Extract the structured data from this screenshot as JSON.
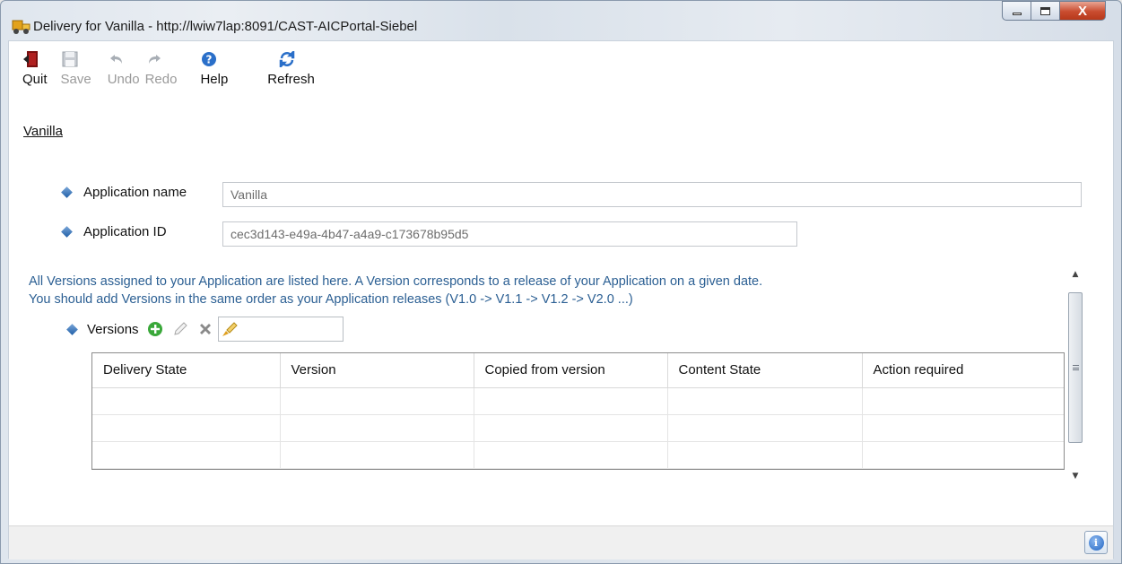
{
  "window": {
    "title": "Delivery for Vanilla - http://lwiw7lap:8091/CAST-AICPortal-Siebel",
    "app_icon": "delivery-truck-icon",
    "close_glyph": "X"
  },
  "toolbar": {
    "items": [
      {
        "label": "Quit",
        "icon": "quit-door-icon",
        "enabled": true
      },
      {
        "label": "Save",
        "icon": "save-disk-icon",
        "enabled": false
      },
      {
        "label": "Undo",
        "icon": "undo-arrow-icon",
        "enabled": false
      },
      {
        "label": "Redo",
        "icon": "redo-arrow-icon",
        "enabled": false
      },
      {
        "label": "Help",
        "icon": "help-circle-icon",
        "enabled": true
      },
      {
        "label": "Refresh",
        "icon": "refresh-icon",
        "enabled": true
      }
    ]
  },
  "breadcrumb": {
    "label": "Vanilla"
  },
  "form": {
    "app_name_label": "Application name",
    "app_name_value": "Vanilla",
    "app_id_label": "Application ID",
    "app_id_value": "cec3d143-e49a-4b47-a4a9-c173678b95d5"
  },
  "info": {
    "line1": "All Versions assigned to your Application are listed here. A Version corresponds to a release of your Application on a given date.",
    "line2": "You should add Versions in the same order as your Application releases (V1.0 -> V1.1 -> V1.2 -> V2.0 ...)"
  },
  "versions": {
    "label": "Versions",
    "filter_value": "",
    "columns": [
      "Delivery State",
      "Version",
      "Copied from version",
      "Content State",
      "Action required"
    ],
    "rows": [
      [
        "",
        "",
        "",
        "",
        ""
      ],
      [
        "",
        "",
        "",
        "",
        ""
      ],
      [
        "",
        "",
        "",
        "",
        ""
      ]
    ]
  },
  "scrollbar": {
    "up_glyph": "▲",
    "down_glyph": "▼"
  },
  "statusbar": {
    "info_glyph": "i"
  },
  "colors": {
    "accent_blue": "#2b5f93",
    "close_red": "#c94c2f",
    "add_green": "#3aa83a"
  }
}
